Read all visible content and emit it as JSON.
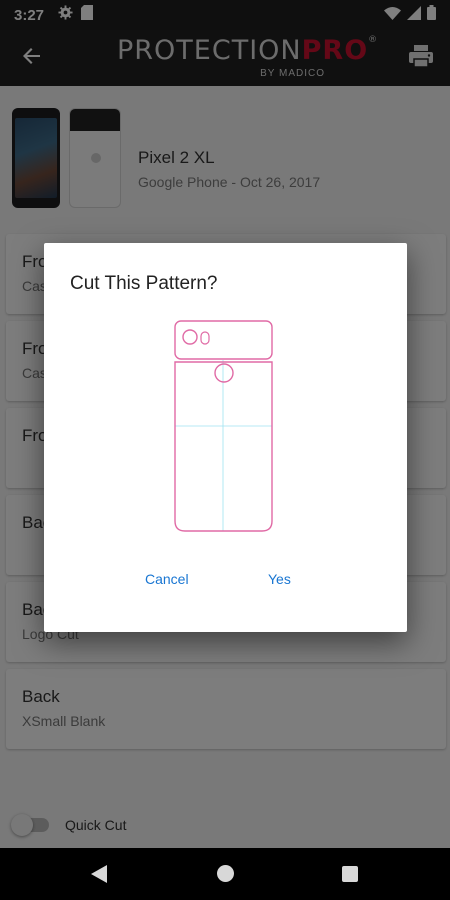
{
  "status_bar": {
    "time": "3:27",
    "icons": [
      "settings-icon",
      "sd-card-icon",
      "wifi-icon",
      "signal-icon",
      "battery-icon"
    ]
  },
  "app_bar": {
    "logo_main": "PROTECTION",
    "logo_pro": "PRO",
    "logo_tm": "®",
    "logo_sub": "BY MADICO",
    "brand_color": "#c8102e",
    "icons": [
      "back-arrow-icon",
      "print-icon"
    ]
  },
  "device": {
    "name": "Pixel 2 XL",
    "meta": "Google Phone - Oct 26, 2017"
  },
  "patterns": [
    {
      "title": "Fro",
      "subtitle": "Cas"
    },
    {
      "title": "Fro",
      "subtitle": "Cas"
    },
    {
      "title": "Fro",
      "subtitle": ""
    },
    {
      "title": "Bac",
      "subtitle": ""
    },
    {
      "title": "Bac",
      "subtitle": "Logo Cut"
    },
    {
      "title": "Back",
      "subtitle": "XSmall Blank"
    }
  ],
  "quick_cut": {
    "label": "Quick Cut",
    "enabled": false
  },
  "dialog": {
    "title": "Cut This Pattern?",
    "cancel_label": "Cancel",
    "yes_label": "Yes",
    "accent_color": "#1976d2",
    "pattern_stroke_color": "#e06aa5",
    "pattern_guide_color": "#9fe3f0"
  },
  "nav_bar": {
    "icons": [
      "nav-back-icon",
      "nav-home-icon",
      "nav-recents-icon"
    ]
  }
}
